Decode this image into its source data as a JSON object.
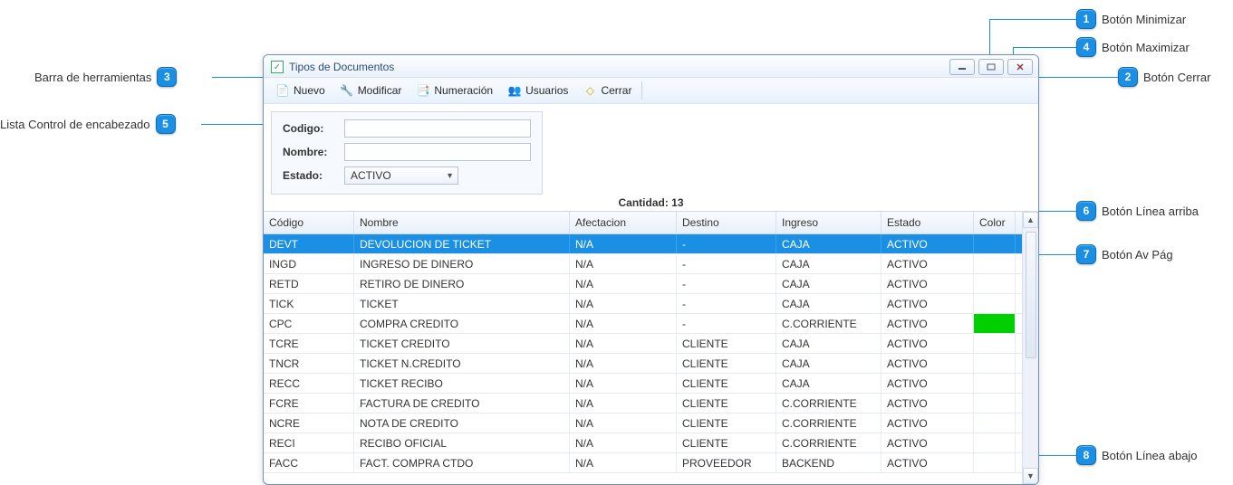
{
  "callouts": {
    "c1": "Botón Minimizar",
    "c2": "Botón Cerrar",
    "c3": "Barra de herramientas",
    "c4": "Botón Maximizar",
    "c5": "Lista Control de encabezado",
    "c6": "Botón Línea arriba",
    "c7": "Botón Av Pág",
    "c8": "Botón Línea abajo"
  },
  "window": {
    "title": "Tipos de Documentos"
  },
  "toolbar": {
    "nuevo": "Nuevo",
    "modificar": "Modificar",
    "numeracion": "Numeración",
    "usuarios": "Usuarios",
    "cerrar": "Cerrar"
  },
  "filters": {
    "codigo_label": "Codigo:",
    "codigo_value": "",
    "nombre_label": "Nombre:",
    "nombre_value": "",
    "estado_label": "Estado:",
    "estado_value": "ACTIVO"
  },
  "cantidad_label": "Cantidad:  13",
  "grid": {
    "headers": {
      "codigo": "Código",
      "nombre": "Nombre",
      "afectacion": "Afectacion",
      "destino": "Destino",
      "ingreso": "Ingreso",
      "estado": "Estado",
      "color": "Color"
    },
    "rows": [
      {
        "codigo": "DEVT",
        "nombre": "DEVOLUCION DE TICKET",
        "afectacion": "N/A",
        "destino": "-",
        "ingreso": "CAJA",
        "estado": "ACTIVO",
        "color": null,
        "selected": true
      },
      {
        "codigo": "INGD",
        "nombre": "INGRESO DE DINERO",
        "afectacion": "N/A",
        "destino": "-",
        "ingreso": "CAJA",
        "estado": "ACTIVO",
        "color": null
      },
      {
        "codigo": "RETD",
        "nombre": "RETIRO DE DINERO",
        "afectacion": "N/A",
        "destino": "-",
        "ingreso": "CAJA",
        "estado": "ACTIVO",
        "color": null
      },
      {
        "codigo": "TICK",
        "nombre": "TICKET",
        "afectacion": "N/A",
        "destino": "-",
        "ingreso": "CAJA",
        "estado": "ACTIVO",
        "color": null
      },
      {
        "codigo": "CPC",
        "nombre": "COMPRA CREDITO",
        "afectacion": "N/A",
        "destino": "-",
        "ingreso": "C.CORRIENTE",
        "estado": "ACTIVO",
        "color": "#00d000"
      },
      {
        "codigo": "TCRE",
        "nombre": "TICKET CREDITO",
        "afectacion": "N/A",
        "destino": "CLIENTE",
        "ingreso": "CAJA",
        "estado": "ACTIVO",
        "color": null
      },
      {
        "codigo": "TNCR",
        "nombre": "TICKET N.CREDITO",
        "afectacion": "N/A",
        "destino": "CLIENTE",
        "ingreso": "CAJA",
        "estado": "ACTIVO",
        "color": null
      },
      {
        "codigo": "RECC",
        "nombre": "TICKET RECIBO",
        "afectacion": "N/A",
        "destino": "CLIENTE",
        "ingreso": "CAJA",
        "estado": "ACTIVO",
        "color": null
      },
      {
        "codigo": "FCRE",
        "nombre": "FACTURA DE CREDITO",
        "afectacion": "N/A",
        "destino": "CLIENTE",
        "ingreso": "C.CORRIENTE",
        "estado": "ACTIVO",
        "color": null
      },
      {
        "codigo": "NCRE",
        "nombre": "NOTA DE CREDITO",
        "afectacion": "N/A",
        "destino": "CLIENTE",
        "ingreso": "C.CORRIENTE",
        "estado": "ACTIVO",
        "color": null
      },
      {
        "codigo": "RECI",
        "nombre": "RECIBO OFICIAL",
        "afectacion": "N/A",
        "destino": "CLIENTE",
        "ingreso": "C.CORRIENTE",
        "estado": "ACTIVO",
        "color": null
      },
      {
        "codigo": "FACC",
        "nombre": "FACT. COMPRA CTDO",
        "afectacion": "N/A",
        "destino": "PROVEEDOR",
        "ingreso": "BACKEND",
        "estado": "ACTIVO",
        "color": null
      }
    ]
  }
}
